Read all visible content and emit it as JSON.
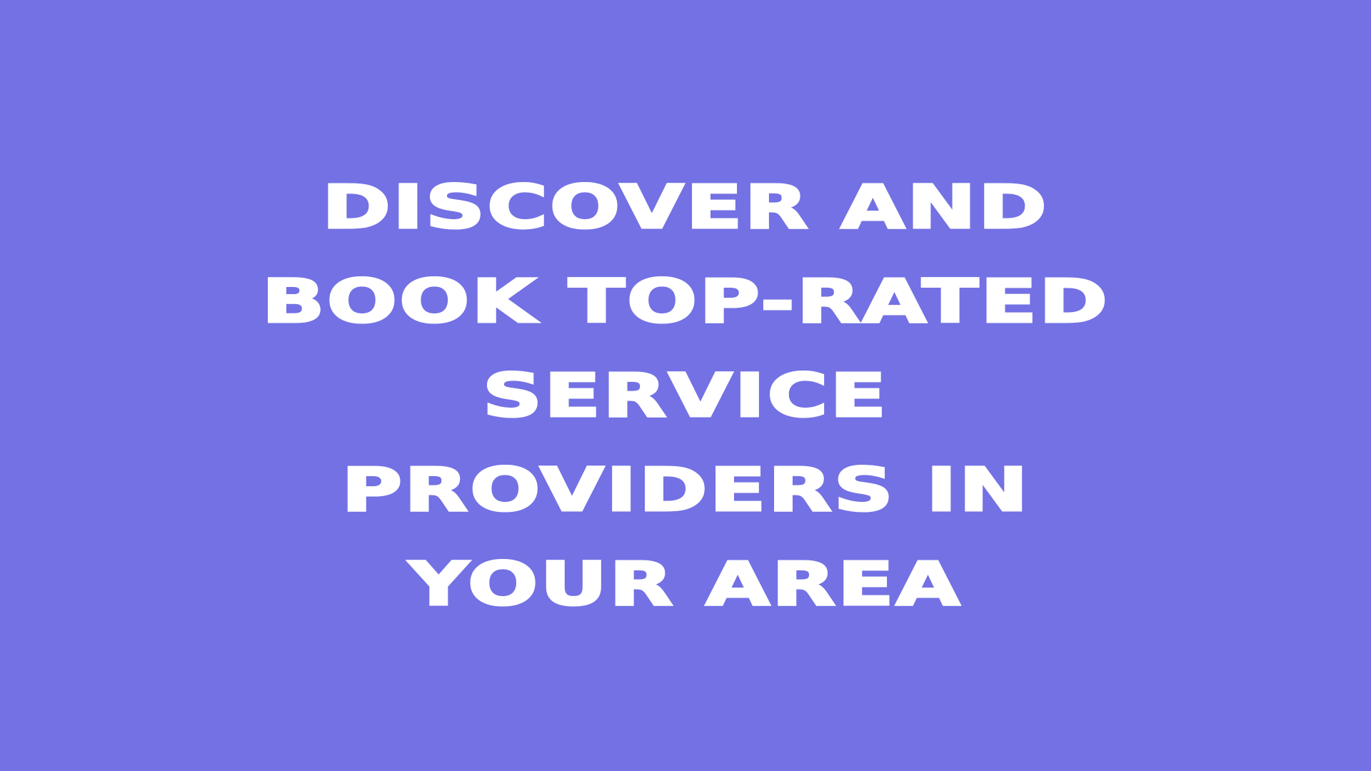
{
  "headline": {
    "lines": [
      "DISCOVER AND",
      "BOOK TOP-RATED",
      "SERVICE",
      "PROVIDERS IN",
      "YOUR AREA"
    ]
  },
  "colors": {
    "background": "#7371e4",
    "text": "#ffffff"
  }
}
